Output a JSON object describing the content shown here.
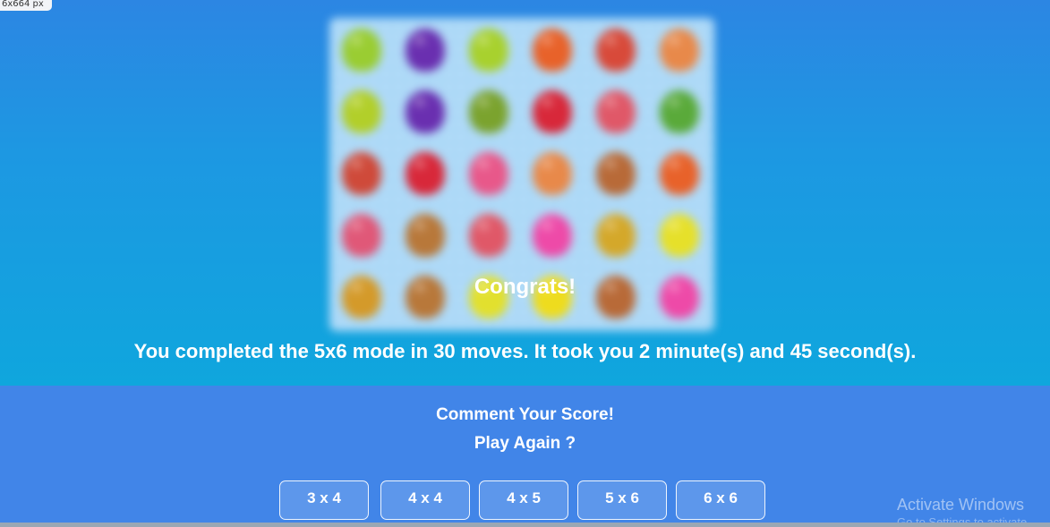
{
  "size_tag": "6x664 px",
  "board": {
    "tiles": [
      {
        "fruit": "lime",
        "color": "#9acd32"
      },
      {
        "fruit": "plum",
        "color": "#6a2fb0"
      },
      {
        "fruit": "lime",
        "color": "#a8d12e"
      },
      {
        "fruit": "orange",
        "color": "#e8622a"
      },
      {
        "fruit": "watermelon",
        "color": "#d84a3a"
      },
      {
        "fruit": "papaya",
        "color": "#e8894a"
      },
      {
        "fruit": "lime",
        "color": "#b2cf2a"
      },
      {
        "fruit": "plum",
        "color": "#6a2fb0"
      },
      {
        "fruit": "avocado",
        "color": "#7ba32e"
      },
      {
        "fruit": "strawberry",
        "color": "#d8283a"
      },
      {
        "fruit": "lychee",
        "color": "#e05868"
      },
      {
        "fruit": "melon",
        "color": "#5aaa3a"
      },
      {
        "fruit": "watermelon",
        "color": "#cf4a3a"
      },
      {
        "fruit": "strawberry",
        "color": "#d8283a"
      },
      {
        "fruit": "dragonfruit",
        "color": "#e8588a"
      },
      {
        "fruit": "papaya",
        "color": "#e8894a"
      },
      {
        "fruit": "kiwi",
        "color": "#b86a38"
      },
      {
        "fruit": "orange",
        "color": "#e8622a"
      },
      {
        "fruit": "dragonfruit",
        "color": "#e05878"
      },
      {
        "fruit": "kiwi",
        "color": "#b8783a"
      },
      {
        "fruit": "lychee",
        "color": "#e05868"
      },
      {
        "fruit": "pitaya",
        "color": "#ee4aa8"
      },
      {
        "fruit": "pineapple",
        "color": "#d4a82a"
      },
      {
        "fruit": "lemon",
        "color": "#e6e02a"
      },
      {
        "fruit": "pineapple",
        "color": "#d49a2a"
      },
      {
        "fruit": "kiwi",
        "color": "#b8783a"
      },
      {
        "fruit": "lemon",
        "color": "#e2e02e"
      },
      {
        "fruit": "lemon",
        "color": "#eedc1e"
      },
      {
        "fruit": "kiwi",
        "color": "#b86a38"
      },
      {
        "fruit": "pitaya",
        "color": "#ee4aa8"
      }
    ]
  },
  "result": {
    "title": "Congrats!",
    "summary": "You completed the 5x6 mode in 30 moves. It took you 2 minute(s) and 45 second(s)."
  },
  "footer": {
    "comment_label": "Comment Your Score!",
    "play_again_label": "Play Again ?",
    "modes": [
      {
        "label": "3 x 4"
      },
      {
        "label": "4 x 4"
      },
      {
        "label": "4 x 5"
      },
      {
        "label": "5 x 6"
      },
      {
        "label": "6 x 6"
      }
    ]
  },
  "watermark": {
    "title": "Activate Windows",
    "subtitle": "Go to Settings to activate"
  }
}
